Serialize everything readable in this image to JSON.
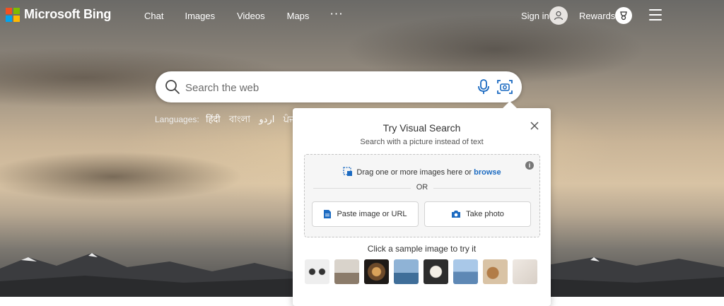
{
  "brand": {
    "name": "Microsoft Bing",
    "colors": [
      "#f25022",
      "#7fba00",
      "#00a4ef",
      "#ffb900"
    ]
  },
  "nav": {
    "chat": "Chat",
    "images": "Images",
    "videos": "Videos",
    "maps": "Maps",
    "more": "···"
  },
  "account": {
    "signin": "Sign in",
    "rewards": "Rewards"
  },
  "search": {
    "placeholder": "Search the web"
  },
  "languages": {
    "label": "Languages:",
    "items": [
      "हिंदी",
      "বাংলা",
      "اردو",
      "ਪੰਜਾਬੀ"
    ]
  },
  "visual_search": {
    "title": "Try Visual Search",
    "subtitle": "Search with a picture instead of text",
    "drag_text": "Drag one or more images here or",
    "browse": "browse",
    "or": "OR",
    "paste_button": "Paste image or URL",
    "photo_button": "Take photo",
    "sample_label": "Click a sample image to try it",
    "accent": "#1b6ac1",
    "samples": [
      "sample-glasses",
      "sample-interior",
      "sample-food",
      "sample-city",
      "sample-flower",
      "sample-tent",
      "sample-dogs",
      "sample-decor"
    ]
  }
}
